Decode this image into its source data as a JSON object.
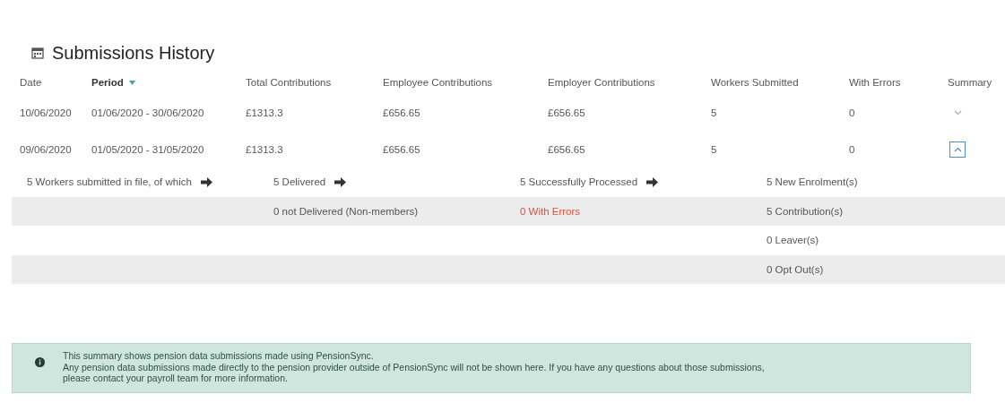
{
  "title": "Submissions History",
  "columns": [
    {
      "label": "Date",
      "sorted": false
    },
    {
      "label": "Period",
      "sorted": true
    },
    {
      "label": "Total Contributions",
      "sorted": false
    },
    {
      "label": "Employee Contributions",
      "sorted": false
    },
    {
      "label": "Employer Contributions",
      "sorted": false
    },
    {
      "label": "Workers Submitted",
      "sorted": false
    },
    {
      "label": "With Errors",
      "sorted": false
    },
    {
      "label": "Summary",
      "sorted": false
    }
  ],
  "rows": [
    {
      "cells": [
        "10/06/2020",
        "01/06/2020 - 30/06/2020",
        "£1313.3",
        "£656.65",
        "£656.65",
        "5",
        "0"
      ],
      "expanded": false
    },
    {
      "cells": [
        "09/06/2020",
        "01/05/2020 - 31/05/2020",
        "£1313.3",
        "£656.65",
        "£656.65",
        "5",
        "0"
      ],
      "expanded": true
    }
  ],
  "summary_rows": [
    {
      "cells": [
        {
          "text": "5 Workers submitted in file, of which",
          "kind": "normal",
          "arrow": true
        },
        {
          "text": "5 Delivered",
          "kind": "normal",
          "arrow": true
        },
        {
          "text": "5 Successfully Processed",
          "kind": "normal",
          "arrow": true
        },
        {
          "text": "5 New Enrolment(s)",
          "kind": "normal",
          "arrow": false
        }
      ]
    },
    {
      "cells": [
        null,
        {
          "text": "0 not Delivered (Non-members)",
          "kind": "normal",
          "arrow": false
        },
        {
          "text": "0 With Errors",
          "kind": "error",
          "arrow": false
        },
        {
          "text": "5 Contribution(s)",
          "kind": "normal",
          "arrow": false
        }
      ]
    },
    {
      "cells": [
        null,
        null,
        null,
        {
          "text": "0 Leaver(s)",
          "kind": "normal",
          "arrow": false
        }
      ]
    },
    {
      "cells": [
        null,
        null,
        null,
        {
          "text": "0 Opt Out(s)",
          "kind": "normal",
          "arrow": false
        }
      ]
    }
  ],
  "info": {
    "lines": [
      "This summary shows pension data submissions made using PensionSync.",
      "Any pension data submissions made directly to the pension provider outside of PensionSync will not be shown here. If you have any questions about those submissions,",
      "please contact your payroll team for more information."
    ]
  }
}
